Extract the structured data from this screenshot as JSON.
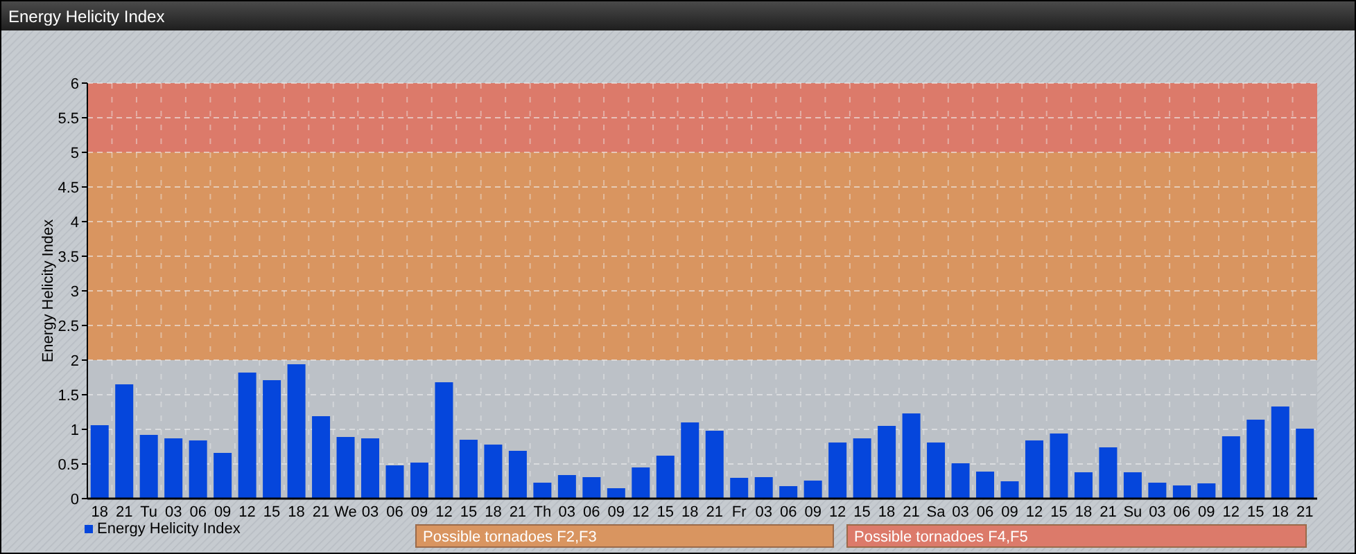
{
  "window": {
    "title": "Energy Helicity Index"
  },
  "chart": {
    "chart_data": {
      "type": "bar",
      "ylabel": "Energy Helicity Index",
      "categories": [
        "18",
        "21",
        "Tu",
        "03",
        "06",
        "09",
        "12",
        "15",
        "18",
        "21",
        "We",
        "03",
        "06",
        "09",
        "12",
        "15",
        "18",
        "21",
        "Th",
        "03",
        "06",
        "09",
        "12",
        "15",
        "18",
        "21",
        "Fr",
        "03",
        "06",
        "09",
        "12",
        "15",
        "18",
        "21",
        "Sa",
        "03",
        "06",
        "09",
        "12",
        "15",
        "18",
        "21",
        "Su",
        "03",
        "06",
        "09",
        "12",
        "15",
        "18",
        "21"
      ],
      "series": [
        {
          "name": "Energy Helicity Index",
          "color": "#0546dc",
          "values": [
            1.06,
            1.65,
            0.92,
            0.87,
            0.84,
            0.66,
            1.82,
            1.71,
            1.94,
            1.19,
            0.89,
            0.87,
            0.48,
            0.52,
            1.68,
            0.85,
            0.78,
            0.69,
            0.23,
            0.34,
            0.31,
            0.15,
            0.45,
            0.62,
            1.1,
            0.98,
            0.3,
            0.31,
            0.18,
            0.26,
            0.81,
            0.87,
            1.05,
            1.23,
            0.81,
            0.51,
            0.39,
            0.25,
            0.84,
            0.94,
            0.38,
            0.74,
            0.38,
            0.23,
            0.19,
            0.22,
            0.9,
            1.14,
            1.33,
            1.01
          ]
        }
      ],
      "ylim": [
        0,
        6
      ],
      "yticks": [
        0,
        0.5,
        1,
        1.5,
        2,
        2.5,
        3,
        3.5,
        4,
        4.5,
        5,
        5.5,
        6
      ],
      "grid": true,
      "bands": [
        {
          "axis": "y",
          "from": 2,
          "to": 5,
          "color": "#d99560"
        },
        {
          "axis": "y",
          "from": 5,
          "to": 6,
          "color": "#dc7a6a"
        }
      ]
    },
    "band_legend": [
      {
        "label": "Possible tornadoes F2,F3"
      },
      {
        "label": "Possible tornadoes F4,F5"
      }
    ]
  }
}
